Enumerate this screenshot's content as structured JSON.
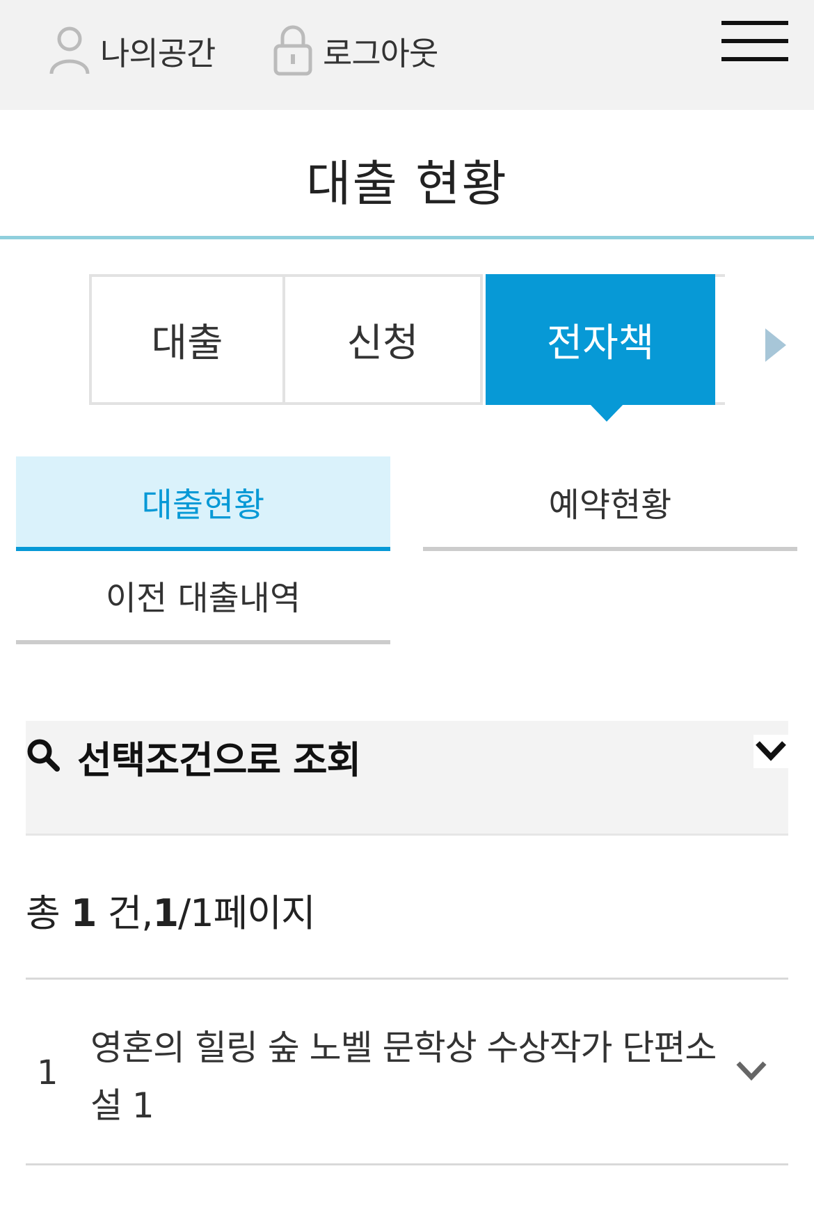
{
  "header": {
    "my_space_label": "나의공간",
    "logout_label": "로그아웃",
    "menu_icon": "hamburger-menu-icon"
  },
  "page": {
    "title": "대출 현황"
  },
  "tabs": [
    {
      "label": "대출",
      "active": false
    },
    {
      "label": "신청",
      "active": false
    },
    {
      "label": "전자책",
      "active": true
    }
  ],
  "subtabs": [
    {
      "label": "대출현황",
      "active": true
    },
    {
      "label": "예약현황",
      "active": false
    },
    {
      "label": "이전 대출내역",
      "active": false
    }
  ],
  "search": {
    "label": "선택조건으로 조회",
    "icon": "search-icon"
  },
  "summary": {
    "prefix": "총 ",
    "total": "1",
    "unit": " 건,",
    "current_page": "1",
    "pages_suffix": "/1페이지"
  },
  "results": [
    {
      "index": "1",
      "title": "영혼의 힐링 숲 노벨 문학상 수상작가 단편소설 1"
    }
  ],
  "colors": {
    "accent": "#0799d6",
    "accent_light": "#daf2fb",
    "title_rule": "#8fcfdd",
    "topbar_bg": "#f2f2f2"
  }
}
